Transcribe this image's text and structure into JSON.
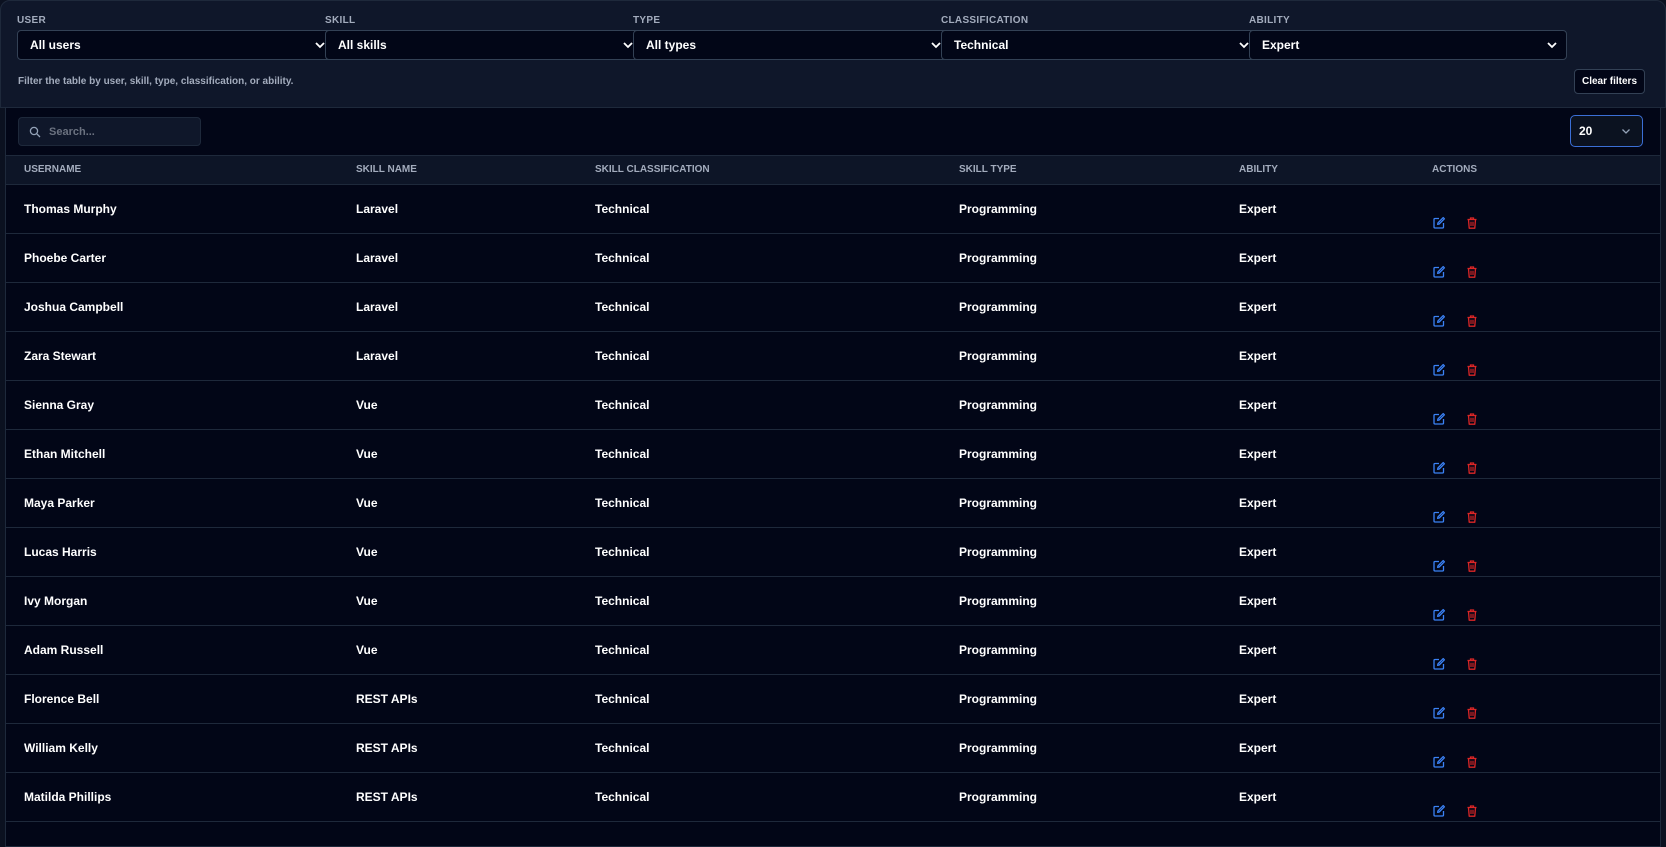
{
  "filters": [
    {
      "label": "USER",
      "value": "All users"
    },
    {
      "label": "SKILL",
      "value": "All skills"
    },
    {
      "label": "TYPE",
      "value": "All types"
    },
    {
      "label": "CLASSIFICATION",
      "value": "Technical"
    },
    {
      "label": "ABILITY",
      "value": "Expert"
    }
  ],
  "helper_text": "Filter the table by user, skill, type, classification, or ability.",
  "clear_filters_label": "Clear filters",
  "search": {
    "placeholder": "Search..."
  },
  "per_page": {
    "value": "20"
  },
  "columns": [
    "USERNAME",
    "SKILL NAME",
    "SKILL CLASSIFICATION",
    "SKILL TYPE",
    "ABILITY",
    "ACTIONS"
  ],
  "rows": [
    {
      "username": "Thomas Murphy",
      "skill": "Laravel",
      "classification": "Technical",
      "type": "Programming",
      "ability": "Expert"
    },
    {
      "username": "Phoebe Carter",
      "skill": "Laravel",
      "classification": "Technical",
      "type": "Programming",
      "ability": "Expert"
    },
    {
      "username": "Joshua Campbell",
      "skill": "Laravel",
      "classification": "Technical",
      "type": "Programming",
      "ability": "Expert"
    },
    {
      "username": "Zara Stewart",
      "skill": "Laravel",
      "classification": "Technical",
      "type": "Programming",
      "ability": "Expert"
    },
    {
      "username": "Sienna Gray",
      "skill": "Vue",
      "classification": "Technical",
      "type": "Programming",
      "ability": "Expert"
    },
    {
      "username": "Ethan Mitchell",
      "skill": "Vue",
      "classification": "Technical",
      "type": "Programming",
      "ability": "Expert"
    },
    {
      "username": "Maya Parker",
      "skill": "Vue",
      "classification": "Technical",
      "type": "Programming",
      "ability": "Expert"
    },
    {
      "username": "Lucas Harris",
      "skill": "Vue",
      "classification": "Technical",
      "type": "Programming",
      "ability": "Expert"
    },
    {
      "username": "Ivy Morgan",
      "skill": "Vue",
      "classification": "Technical",
      "type": "Programming",
      "ability": "Expert"
    },
    {
      "username": "Adam Russell",
      "skill": "Vue",
      "classification": "Technical",
      "type": "Programming",
      "ability": "Expert"
    },
    {
      "username": "Florence Bell",
      "skill": "REST APIs",
      "classification": "Technical",
      "type": "Programming",
      "ability": "Expert"
    },
    {
      "username": "William Kelly",
      "skill": "REST APIs",
      "classification": "Technical",
      "type": "Programming",
      "ability": "Expert"
    },
    {
      "username": "Matilda Phillips",
      "skill": "REST APIs",
      "classification": "Technical",
      "type": "Programming",
      "ability": "Expert"
    }
  ],
  "icons": {
    "edit": "edit-icon",
    "delete": "trash-icon",
    "search": "search-icon",
    "dropdown": "chevron-down-icon"
  },
  "colors": {
    "background": "#0b1120",
    "table_background": "#020617",
    "edit_icon": "#3b82f6",
    "delete_icon": "#dc2626",
    "muted_text": "#a3acbd"
  }
}
